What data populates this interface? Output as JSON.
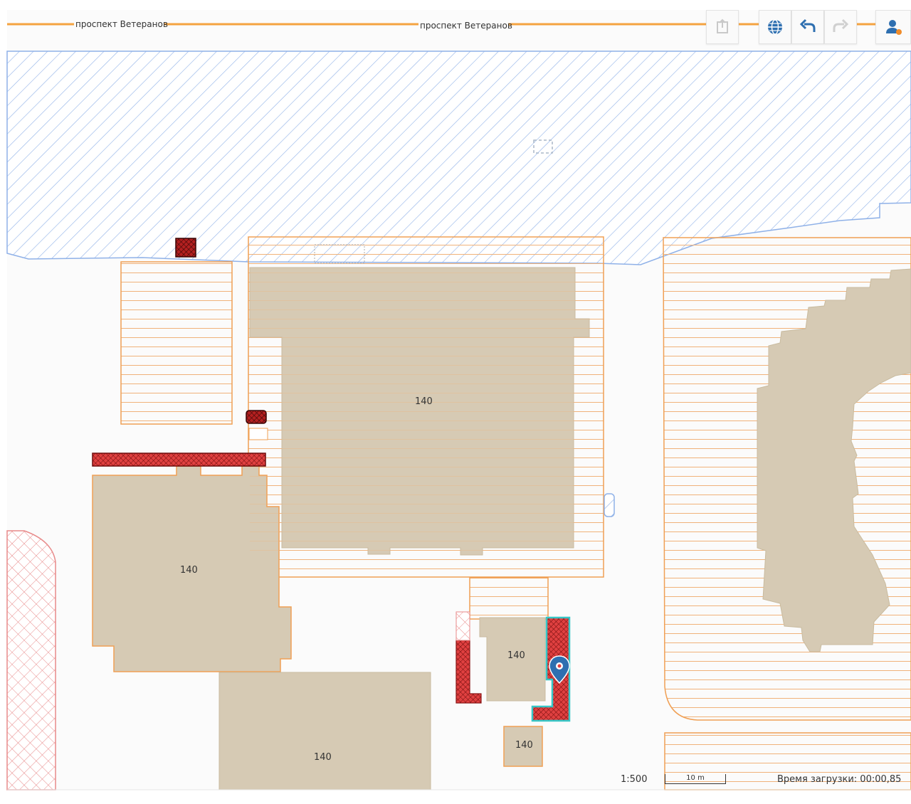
{
  "map": {
    "road_labels": [
      "проспект Ветеранов",
      "проспект Ветеранов"
    ],
    "building_labels": [
      "140",
      "140",
      "140",
      "140",
      "140"
    ]
  },
  "toolbar": {
    "buttons": [
      {
        "icon": "export-icon",
        "enabled": false
      },
      {
        "icon": "globe-icon",
        "enabled": true
      },
      {
        "icon": "undo-icon",
        "enabled": true
      },
      {
        "icon": "redo-icon",
        "enabled": false
      },
      {
        "icon": "user-icon",
        "enabled": true
      }
    ]
  },
  "status": {
    "scale": "1:500",
    "scale_bar_label": "10 m",
    "load_time": "Время загрузки: 00:00,85"
  },
  "colors": {
    "road": "#f4a340",
    "water_hatch": "#8fb1e8",
    "parcel_outline": "#f0a055",
    "building_fill": "#d6cab4",
    "red_hatch": "#cc2222",
    "selection": "#37c6c6",
    "accent": "#2e6fb0"
  }
}
